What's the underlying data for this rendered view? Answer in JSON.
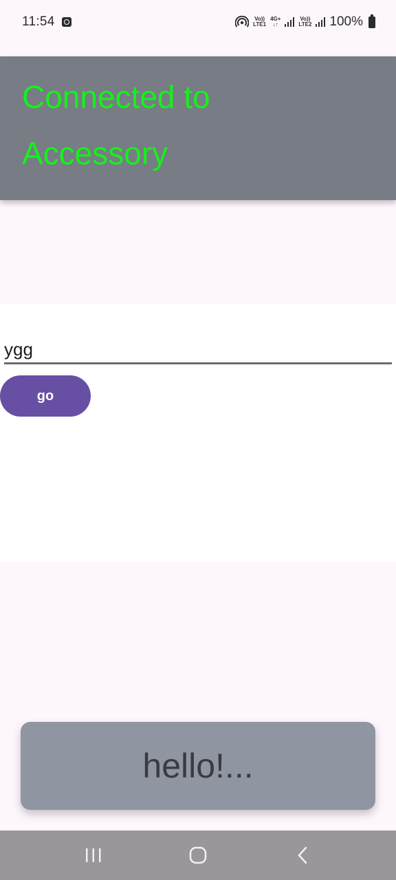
{
  "status_bar": {
    "time": "11:54",
    "volte1": "Vo))",
    "lte1": "LTE1",
    "net_type": "4G+",
    "volte2": "Vo))",
    "lte2": "LTE2",
    "battery": "100%"
  },
  "banner": {
    "title": "Connected to Accessory",
    "text_color": "#16f01b",
    "background": "#777c85"
  },
  "form": {
    "input_value": "ygg",
    "go_label": "go",
    "accent": "#6750a4"
  },
  "toast": {
    "message": "hello!..."
  },
  "nav_bar": {
    "icons": [
      "recent-apps-icon",
      "home-icon",
      "back-icon"
    ]
  }
}
